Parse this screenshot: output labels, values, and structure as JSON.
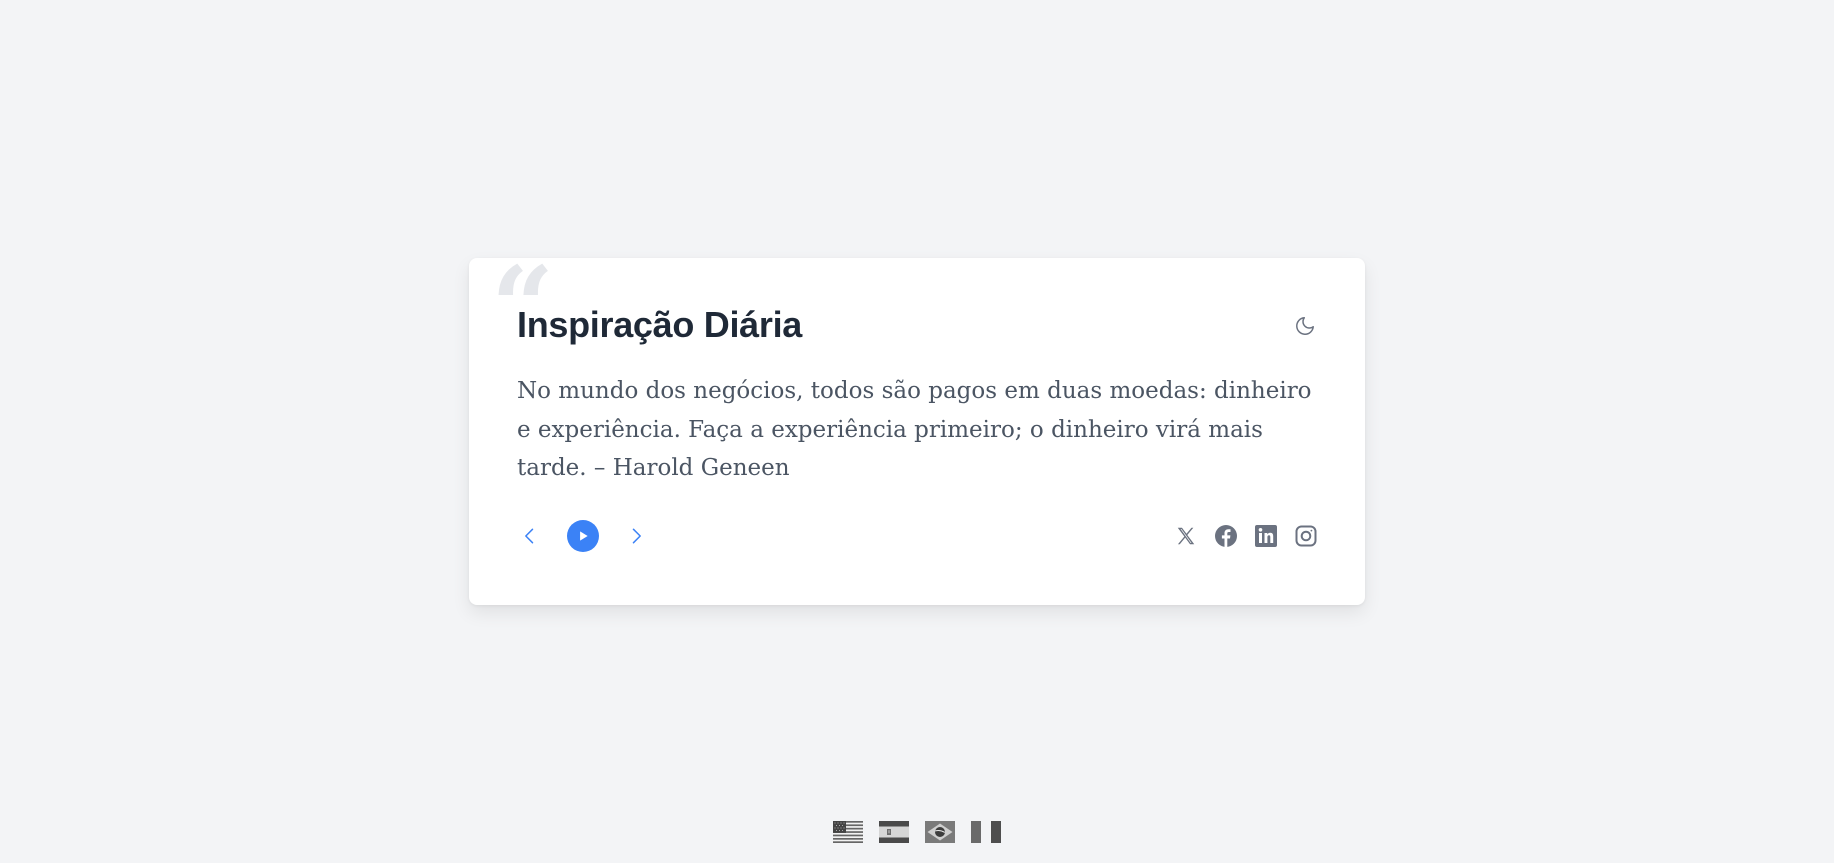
{
  "card": {
    "title": "Inspiração Diária",
    "quote_mark": "“",
    "quote": "No mundo dos negócios, todos são pagos em duas moedas: dinheiro e experiência. Faça a experiência primeiro; o dinheiro virá mais tarde. – Harold Geneen",
    "theme_icon": "moon-icon"
  },
  "controls": {
    "prev_icon": "chevron-left-icon",
    "play_icon": "play-icon",
    "next_icon": "chevron-right-icon"
  },
  "social": {
    "items": [
      "x-icon",
      "facebook-icon",
      "linkedin-icon",
      "instagram-icon"
    ]
  },
  "languages": {
    "items": [
      "us-flag",
      "es-flag",
      "br-flag",
      "it-flag"
    ]
  },
  "colors": {
    "background": "#f3f4f6",
    "card": "#ffffff",
    "title": "#1f2937",
    "quote_text": "#4b5563",
    "accent": "#3b82f6",
    "icon_gray": "#6b7280"
  }
}
